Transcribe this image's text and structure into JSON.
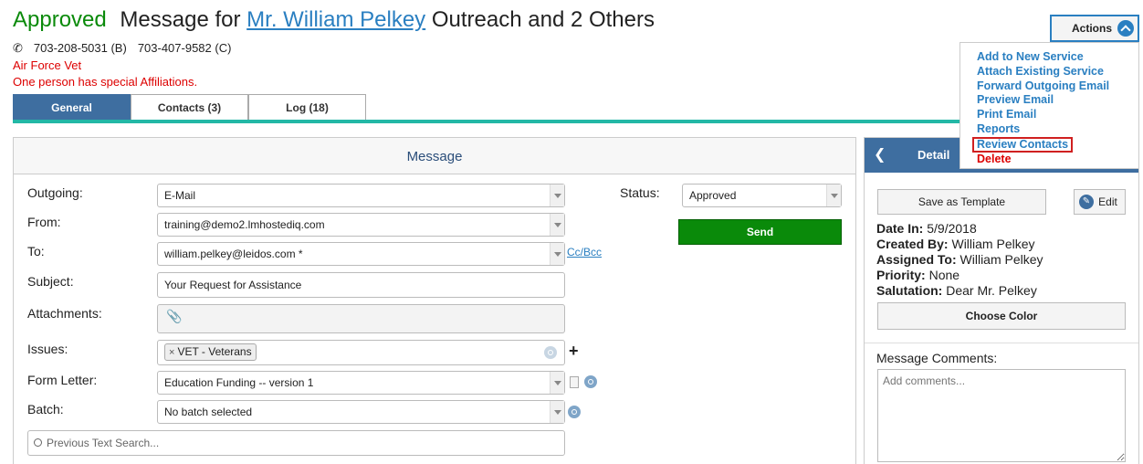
{
  "header": {
    "status": "Approved",
    "title_prefix": "Message for",
    "name_link": "Mr. William Pelkey",
    "title_suffix": "Outreach and 2 Others",
    "phone_b": "703-208-5031 (B)",
    "phone_c": "703-407-9582 (C)",
    "vet_note": "Air Force Vet",
    "affiliation_note": "One person has special Affiliations."
  },
  "tabs": [
    {
      "label": "General"
    },
    {
      "label": "Contacts (3)"
    },
    {
      "label": "Log (18)"
    }
  ],
  "message": {
    "title": "Message",
    "outgoing_label": "Outgoing:",
    "outgoing_value": "E-Mail",
    "from_label": "From:",
    "from_value": "training@demo2.lmhostediq.com",
    "to_label": "To:",
    "to_value": "william.pelkey@leidos.com *",
    "ccbcc": "Cc/Bcc",
    "subject_label": "Subject:",
    "subject_value": "Your Request for Assistance",
    "attachments_label": "Attachments:",
    "issues_label": "Issues:",
    "issue_tag": "VET - Veterans",
    "form_letter_label": "Form Letter:",
    "form_letter_value": "Education Funding -- version 1",
    "batch_label": "Batch:",
    "batch_value": "No batch selected",
    "prev_search_placeholder": "Previous Text Search...",
    "status_label": "Status:",
    "status_value": "Approved",
    "send_label": "Send"
  },
  "detail": {
    "title": "Detail",
    "save_template": "Save as Template",
    "edit": "Edit",
    "date_in_label": "Date In:",
    "date_in": "5/9/2018",
    "created_by_label": "Created By:",
    "created_by": "William Pelkey",
    "assigned_to_label": "Assigned To:",
    "assigned_to": "William Pelkey",
    "priority_label": "Priority:",
    "priority": "None",
    "salutation_label": "Salutation:",
    "salutation": "Dear Mr. Pelkey",
    "choose_color": "Choose Color",
    "comments_label": "Message Comments:",
    "comments_placeholder": "Add comments..."
  },
  "actions": {
    "label": "Actions",
    "items": [
      "Add to New Service",
      "Attach Existing Service",
      "Forward Outgoing Email",
      "Preview Email",
      "Print Email",
      "Reports",
      "Review Contacts",
      "Delete"
    ]
  }
}
